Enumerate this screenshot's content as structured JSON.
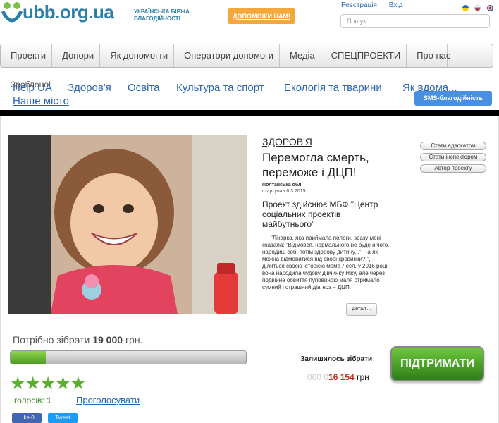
{
  "header": {
    "logo_text": "ubb.org.ua",
    "logo_subtitle": "УКРАЇНСЬКА БІРЖА БЛАГОДІЙНОСТІ",
    "help_button": "ДОПОМОЖИ НАМ!",
    "register_link": "Реєстрація",
    "login_link": "Вхід",
    "search_placeholder": "Пошук..."
  },
  "nav": {
    "items": [
      {
        "label": "Проекти"
      },
      {
        "label": "Донори"
      },
      {
        "label": "Як допомогти"
      },
      {
        "label": "Оператори допомоги"
      },
      {
        "label": "Медіа"
      },
      {
        "label": "СПЕЦПРОЕКТИ"
      },
      {
        "label": "Про нас"
      }
    ]
  },
  "categories": {
    "overlay_text": "Зроблено!",
    "items": [
      {
        "label": "Help UA"
      },
      {
        "label": "Здоров'я"
      },
      {
        "label": "Освіта"
      },
      {
        "label": "Культура та спорт"
      },
      {
        "label": "Екологія та тварини"
      },
      {
        "label": "Як вдома..."
      }
    ],
    "second_row": "Наше місто",
    "sms_button": "SMS-благодійність"
  },
  "project": {
    "category": "ЗДОРОВ'Я",
    "title": "Перемогла смерть, переможе і ДЦП!",
    "region": "Полтавська обл.",
    "started": "стартував 6.3.2019",
    "organization": "Проект здійснює МБФ \"Центр соціальних проектів майбутнього\"",
    "description": "\"Лікарка, яка приймала пологи, зразу мені сказала: \"Відмовся, нормального не буде нічого, народиш собі потім здорову дитину...\". Та як можна відмовитися від своєї кровинки?!\", – ділиться своєю історією мама Леся. у 2016 році вона народила чудову дівчинку Ніку, але через подвійне обвиття пуповиною маля отримало сумний і страшний діагноз – ДЦП.",
    "details_button": "Деталі...",
    "side_buttons": [
      "Стати адвокатом",
      "Стати інспектором",
      "Автор проекту"
    ]
  },
  "funding": {
    "need_prefix": "Потрібно зібрати",
    "need_amount": "19 000",
    "need_currency": "грн.",
    "progress_fraction": 0.15,
    "remaining_label": "Залишилось зібрати",
    "remaining_dim": "000 0",
    "remaining_value": "16 154",
    "remaining_currency": "грн",
    "support_button": "ПІДТРИМАТИ",
    "rating_stars": 5,
    "votes_label": "голосів:",
    "votes_count": "1",
    "vote_link": "Проголосувати",
    "like_button": "Like 0",
    "tweet_button": "Tweet"
  },
  "colors": {
    "link": "#2a64b5",
    "help_orange": "#f5a83a",
    "sms_blue": "#4a90e2",
    "support_green": "#4c9b23",
    "remaining_red": "#c0331e"
  }
}
